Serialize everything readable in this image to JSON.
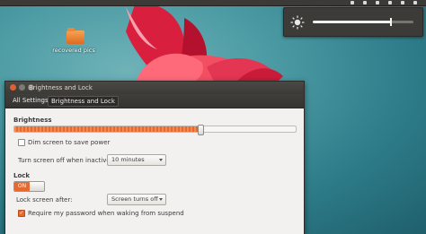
{
  "desktop": {
    "folder_label": "recovered pics"
  },
  "brightness_indicator": {
    "icon": "sun-icon",
    "level": 0.78
  },
  "window": {
    "title": "Brightness and Lock",
    "crumbs": [
      "All Settings",
      "Brightness and Lock"
    ]
  },
  "brightness": {
    "heading": "Brightness",
    "level": 0.66,
    "dim_label": "Dim screen to save power",
    "dim_checked": false,
    "turn_off_label": "Turn screen off when inactive for:",
    "turn_off_value": "10 minutes"
  },
  "lock": {
    "heading": "Lock",
    "toggle_label": "ON",
    "toggle_on": true,
    "after_label": "Lock screen after:",
    "after_value": "Screen turns off",
    "require_password_label": "Require my password when waking from suspend",
    "require_password_checked": true
  },
  "colors": {
    "accent": "#e9692c",
    "panel": "#3c3b37"
  }
}
